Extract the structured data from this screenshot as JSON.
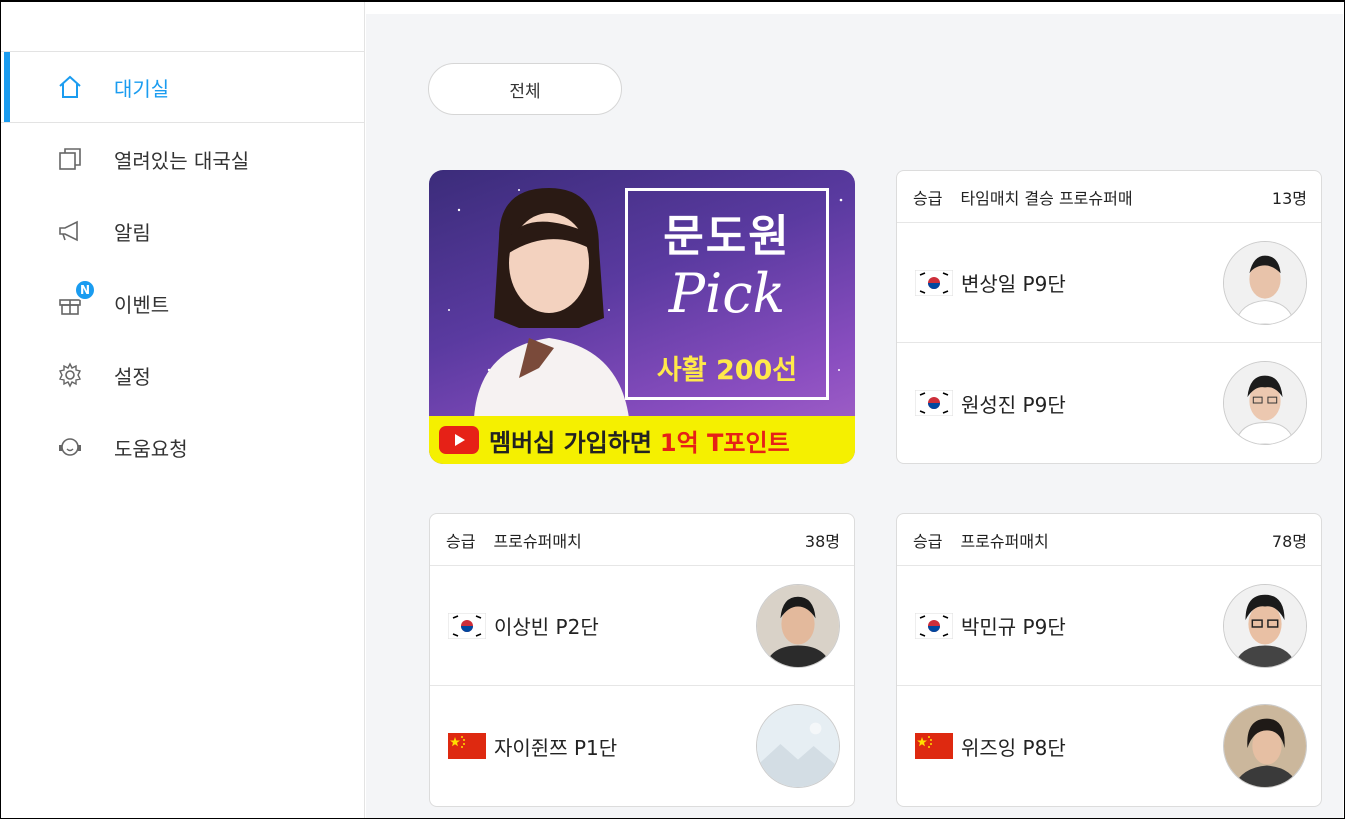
{
  "sidebar": {
    "items": [
      {
        "label": "대기실",
        "icon": "home-icon",
        "active": true
      },
      {
        "label": "열려있는 대국실",
        "icon": "copy-icon",
        "active": false
      },
      {
        "label": "알림",
        "icon": "megaphone-icon",
        "active": false
      },
      {
        "label": "이벤트",
        "icon": "gift-icon",
        "active": false,
        "badge": "N"
      },
      {
        "label": "설정",
        "icon": "gear-icon",
        "active": false
      },
      {
        "label": "도움요청",
        "icon": "headset-icon",
        "active": false
      }
    ]
  },
  "filter": {
    "label": "전체"
  },
  "banner": {
    "title": "문도원",
    "script": "Pick",
    "subtitle": "사활 200선",
    "bar_text": "멤버십 가입하면",
    "bar_highlight": "1억 T포인트"
  },
  "cards": [
    {
      "grade": "승급",
      "title": "타임매치 결승 프로슈퍼매",
      "count": "13명",
      "players": [
        {
          "name": "변상일 P9단",
          "flag": "korea-flag-icon",
          "avatar": "player-photo"
        },
        {
          "name": "원성진 P9단",
          "flag": "korea-flag-icon",
          "avatar": "player-photo"
        }
      ]
    },
    {
      "grade": "승급",
      "title": "프로슈퍼매치",
      "count": "38명",
      "players": [
        {
          "name": "이상빈 P2단",
          "flag": "korea-flag-icon",
          "avatar": "player-photo"
        },
        {
          "name": "자이쥔쯔 P1단",
          "flag": "china-flag-icon",
          "avatar": "placeholder-photo"
        }
      ]
    },
    {
      "grade": "승급",
      "title": "프로슈퍼매치",
      "count": "78명",
      "players": [
        {
          "name": "박민규 P9단",
          "flag": "korea-flag-icon",
          "avatar": "player-photo"
        },
        {
          "name": "위즈잉 P8단",
          "flag": "china-flag-icon",
          "avatar": "player-photo"
        }
      ]
    }
  ],
  "colors": {
    "accent": "#1a9cf0",
    "background": "#f4f5f7",
    "banner_bar": "#f5f000"
  }
}
